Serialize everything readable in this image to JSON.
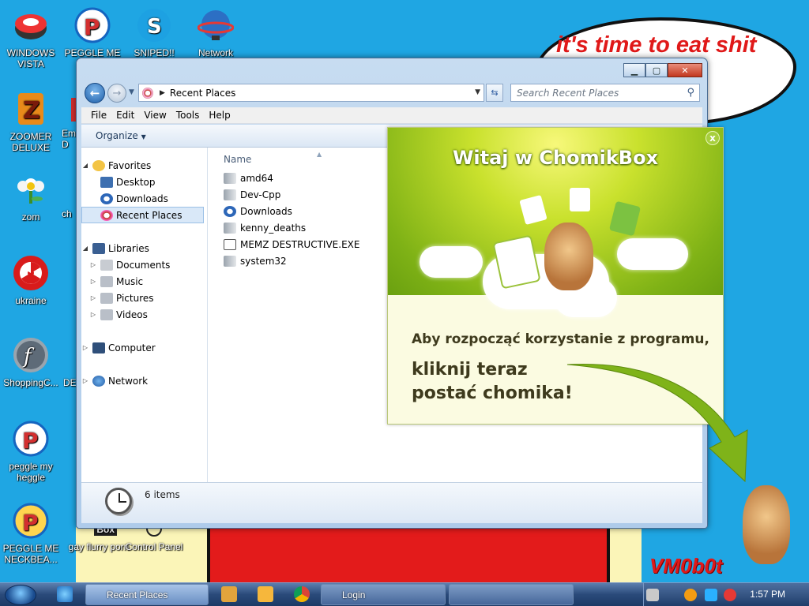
{
  "desktop": {
    "speech_bubble": "it's time to eat shit chew",
    "signature": "VM0b0t",
    "icons": [
      {
        "label": "WINDOWS VISTA"
      },
      {
        "label": "PEGGLE ME N"
      },
      {
        "label": "SNIPED!! EPIC"
      },
      {
        "label": "Network"
      },
      {
        "label": "ZOOMER DELUXE"
      },
      {
        "label": "Em D"
      },
      {
        "label": "zom"
      },
      {
        "label": "ch"
      },
      {
        "label": "ukraine"
      },
      {
        "label": "ShoppingC..."
      },
      {
        "label": "DE"
      },
      {
        "label": "peggle my heggle"
      },
      {
        "label": "PEGGLE ME NECKBEA..."
      },
      {
        "label": "gay flurry porn"
      },
      {
        "label": "Control Panel"
      }
    ],
    "box_badge": "Box"
  },
  "explorer": {
    "address": "Recent Places",
    "search_placeholder": "Search Recent Places",
    "menu": [
      "File",
      "Edit",
      "View",
      "Tools",
      "Help"
    ],
    "organize": "Organize",
    "nav": {
      "favorites": "Favorites",
      "favorites_items": [
        "Desktop",
        "Downloads",
        "Recent Places"
      ],
      "libraries": "Libraries",
      "libraries_items": [
        "Documents",
        "Music",
        "Pictures",
        "Videos"
      ],
      "computer": "Computer",
      "network": "Network"
    },
    "column_name": "Name",
    "files": [
      "amd64",
      "Dev-Cpp",
      "Downloads",
      "kenny_deaths",
      "MEMZ DESTRUCTIVE.EXE",
      "system32"
    ],
    "item_count": "6 items"
  },
  "chomikbox": {
    "title": "Witaj w ChomikBox",
    "close": "x",
    "line1": "Aby rozpocząć korzystanie z programu,",
    "line2a": "kliknij teraz",
    "line2b": "postać chomika!"
  },
  "taskbar": {
    "buttons": [
      "Recent Places",
      "Login",
      ""
    ],
    "time": "1:57 PM"
  }
}
